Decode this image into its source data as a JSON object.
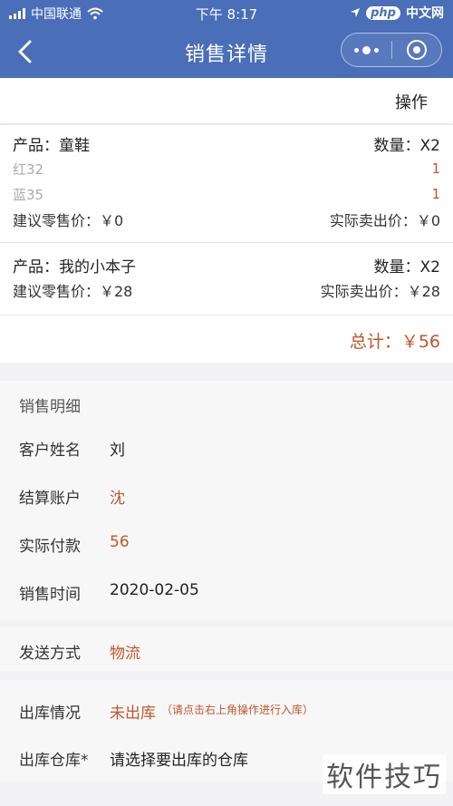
{
  "status": {
    "carrier": "中国联通",
    "time": "下午 8:17",
    "site_logo": "php",
    "site_name": "中文网"
  },
  "nav": {
    "title": "销售详情",
    "back_icon": "chevron-left-icon",
    "more_icon": "more-dots-icon",
    "close_icon": "close-circle-icon"
  },
  "toolbar": {
    "operate_label": "操作"
  },
  "products": [
    {
      "name_label": "产品：童鞋",
      "qty_label": "数量：X2",
      "variants": [
        {
          "name": "红32",
          "qty": "1"
        },
        {
          "name": "蓝35",
          "qty": "1"
        }
      ],
      "suggested_price": "建议零售价：￥0",
      "actual_price": "实际卖出价：￥0"
    },
    {
      "name_label": "产品：我的小本子",
      "qty_label": "数量：X2",
      "suggested_price": "建议零售价：￥28",
      "actual_price": "实际卖出价：￥28"
    }
  ],
  "total": "总计：￥56",
  "detail": {
    "title": "销售明细",
    "fields": [
      {
        "label": "客户姓名",
        "value": "刘"
      },
      {
        "label": "结算账户",
        "value": "沈"
      },
      {
        "label": "实际付款",
        "value": "56"
      },
      {
        "label": "销售时间",
        "value": "2020-02-05"
      }
    ]
  },
  "shipping": {
    "label": "发送方式",
    "value": "物流"
  },
  "stock": {
    "status_label": "出库情况",
    "status_value": "未出库",
    "status_hint": "（请点击右上角操作进行入库）",
    "warehouse_label": "出库仓库*",
    "warehouse_placeholder": "请选择要出库的仓库"
  },
  "watermark": "软件技巧",
  "colors": {
    "nav_bg": "#4a6eb8",
    "accent": "#c0562a"
  }
}
